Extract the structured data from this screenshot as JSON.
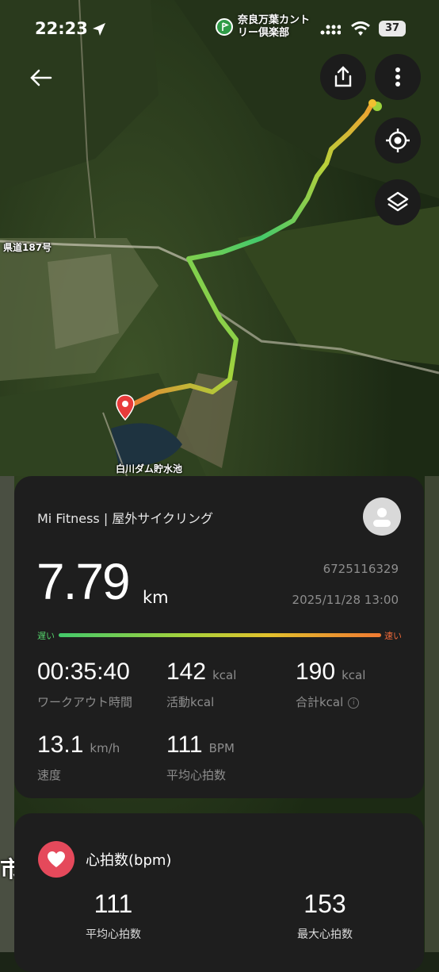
{
  "status_bar": {
    "time": "22:23",
    "poi_name": "奈良万葉カントリー倶楽部",
    "battery": "37"
  },
  "map": {
    "labels": {
      "road": "県道187号",
      "reservoir": "白川ダム貯水池",
      "city_fragment": "市"
    }
  },
  "workout": {
    "source": "Mi Fitness | 屋外サイクリング",
    "distance": "7.79",
    "distance_unit": "km",
    "workout_id": "6725116329",
    "datetime": "2025/11/28 13:00",
    "speed_legend_slow": "遅い",
    "speed_legend_fast": "速い",
    "metrics": [
      {
        "value": "00:35:40",
        "unit": "",
        "label": "ワークアウト時間"
      },
      {
        "value": "142",
        "unit": "kcal",
        "label": "活動kcal"
      },
      {
        "value": "190",
        "unit": "kcal",
        "label": "合計kcal"
      },
      {
        "value": "13.1",
        "unit": "km/h",
        "label": "速度"
      },
      {
        "value": "111",
        "unit": "BPM",
        "label": "平均心拍数"
      }
    ]
  },
  "heart_rate": {
    "title": "心拍数(bpm)",
    "avg_value": "111",
    "avg_label": "平均心拍数",
    "max_value": "153",
    "max_label": "最大心拍数"
  },
  "colors": {
    "card_bg": "#1e1e1e",
    "heart_accent": "#e5495b",
    "slow": "#43c96b",
    "fast": "#f07a32"
  },
  "icons": [
    "back-arrow-icon",
    "share-icon",
    "more-vert-icon",
    "locate-icon",
    "layers-icon",
    "heart-icon",
    "avatar-icon",
    "location-arrow-icon",
    "signal-icon",
    "wifi-icon",
    "pin-icon",
    "golf-icon"
  ]
}
